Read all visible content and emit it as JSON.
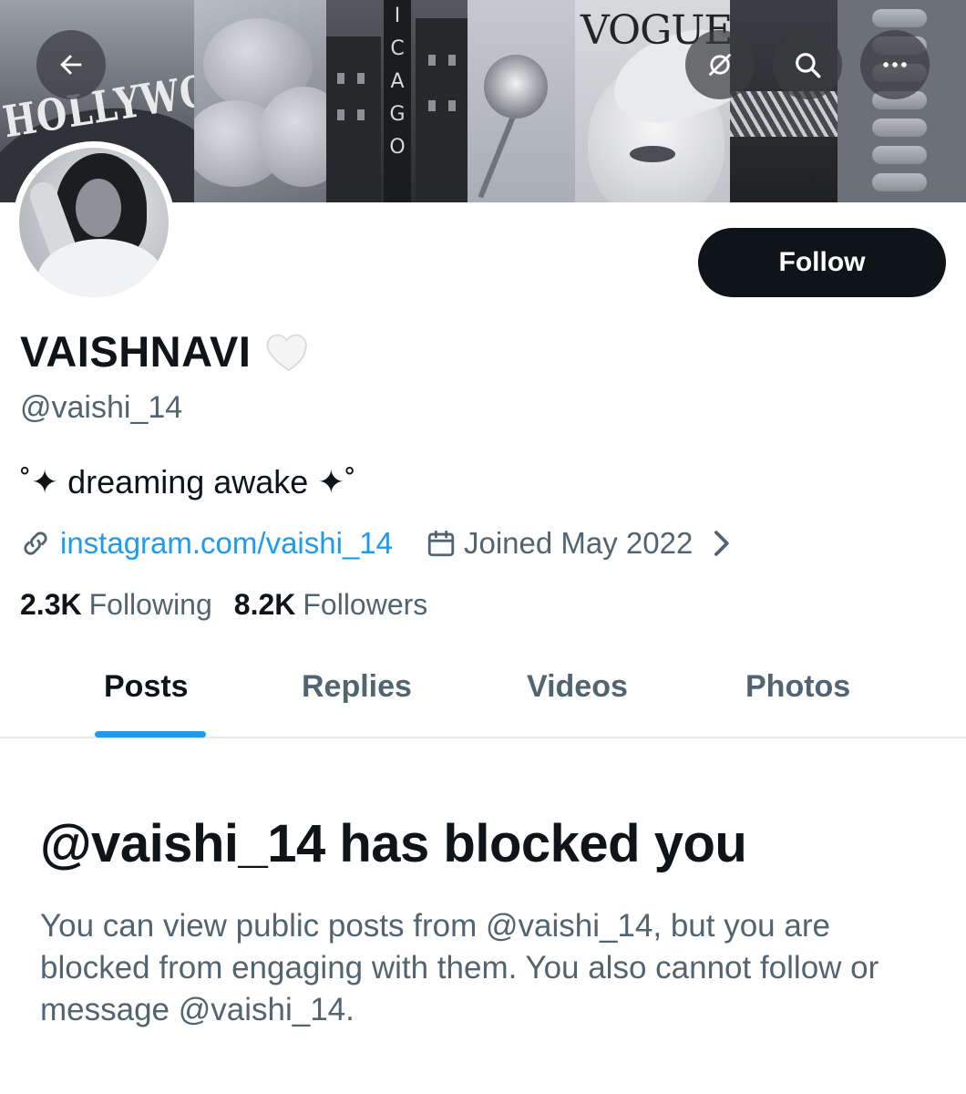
{
  "banner": {
    "back_icon": "arrow-left-icon",
    "notify_icon": "crossed-circle-icon",
    "search_icon": "search-icon",
    "more_icon": "more-dots-icon",
    "collage_text": {
      "hollywood": "HOLLYWOOD",
      "chicago_letters": [
        "I",
        "C",
        "A",
        "G",
        "O"
      ],
      "vogue": "VOGUE"
    }
  },
  "profile": {
    "display_name": "VAISHNAVI",
    "name_emoji": "white-heart-icon",
    "handle": "@vaishi_14",
    "bio": "˚✦ dreaming awake ✦˚",
    "link_icon": "link-icon",
    "link_text": "instagram.com/vaishi_14",
    "calendar_icon": "calendar-icon",
    "joined_text": "Joined May 2022",
    "following_count": "2.3K",
    "following_label": "Following",
    "followers_count": "8.2K",
    "followers_label": "Followers"
  },
  "actions": {
    "follow_label": "Follow"
  },
  "tabs": [
    {
      "label": "Posts",
      "active": true
    },
    {
      "label": "Replies",
      "active": false
    },
    {
      "label": "Videos",
      "active": false
    },
    {
      "label": "Photos",
      "active": false
    }
  ],
  "blocked": {
    "title": "@vaishi_14 has blocked you",
    "message": "You can view public posts from @vaishi_14, but you are blocked from engaging with them. You also cannot follow or message @vaishi_14."
  },
  "colors": {
    "accent": "#1d9bf0",
    "primary_text": "#0f1419",
    "secondary_text": "#536471",
    "follow_button_bg": "#0f1419"
  }
}
